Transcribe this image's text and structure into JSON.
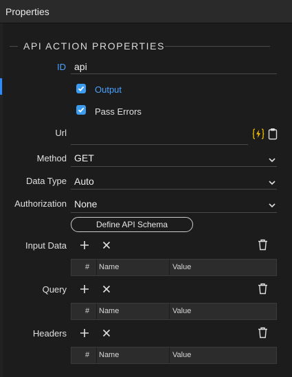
{
  "panel": {
    "title": "Properties"
  },
  "section": {
    "title": "API ACTION PROPERTIES"
  },
  "fields": {
    "id": {
      "label": "ID",
      "value": "api"
    },
    "output": {
      "label": "Output",
      "checked": true
    },
    "pass_errors": {
      "label": "Pass Errors",
      "checked": true
    },
    "url": {
      "label": "Url",
      "value": ""
    },
    "method": {
      "label": "Method",
      "value": "GET"
    },
    "data_type": {
      "label": "Data Type",
      "value": "Auto"
    },
    "authorization": {
      "label": "Authorization",
      "value": "None"
    }
  },
  "define_schema_label": "Define API Schema",
  "tables": [
    {
      "label": "Input Data",
      "cols": [
        "#",
        "Name",
        "Value"
      ]
    },
    {
      "label": "Query",
      "cols": [
        "#",
        "Name",
        "Value"
      ]
    },
    {
      "label": "Headers",
      "cols": [
        "#",
        "Name",
        "Value"
      ]
    }
  ],
  "colors": {
    "accent": "#2b8cff",
    "checkbox": "#3c9cf0",
    "dynamic_icon": "#f0c000",
    "background": "#1c1c1c"
  },
  "icons": [
    "lightning-dynamic-icon",
    "clipboard-icon",
    "chevron-down-icon",
    "plus-icon",
    "close-icon",
    "trash-icon",
    "check-icon"
  ]
}
